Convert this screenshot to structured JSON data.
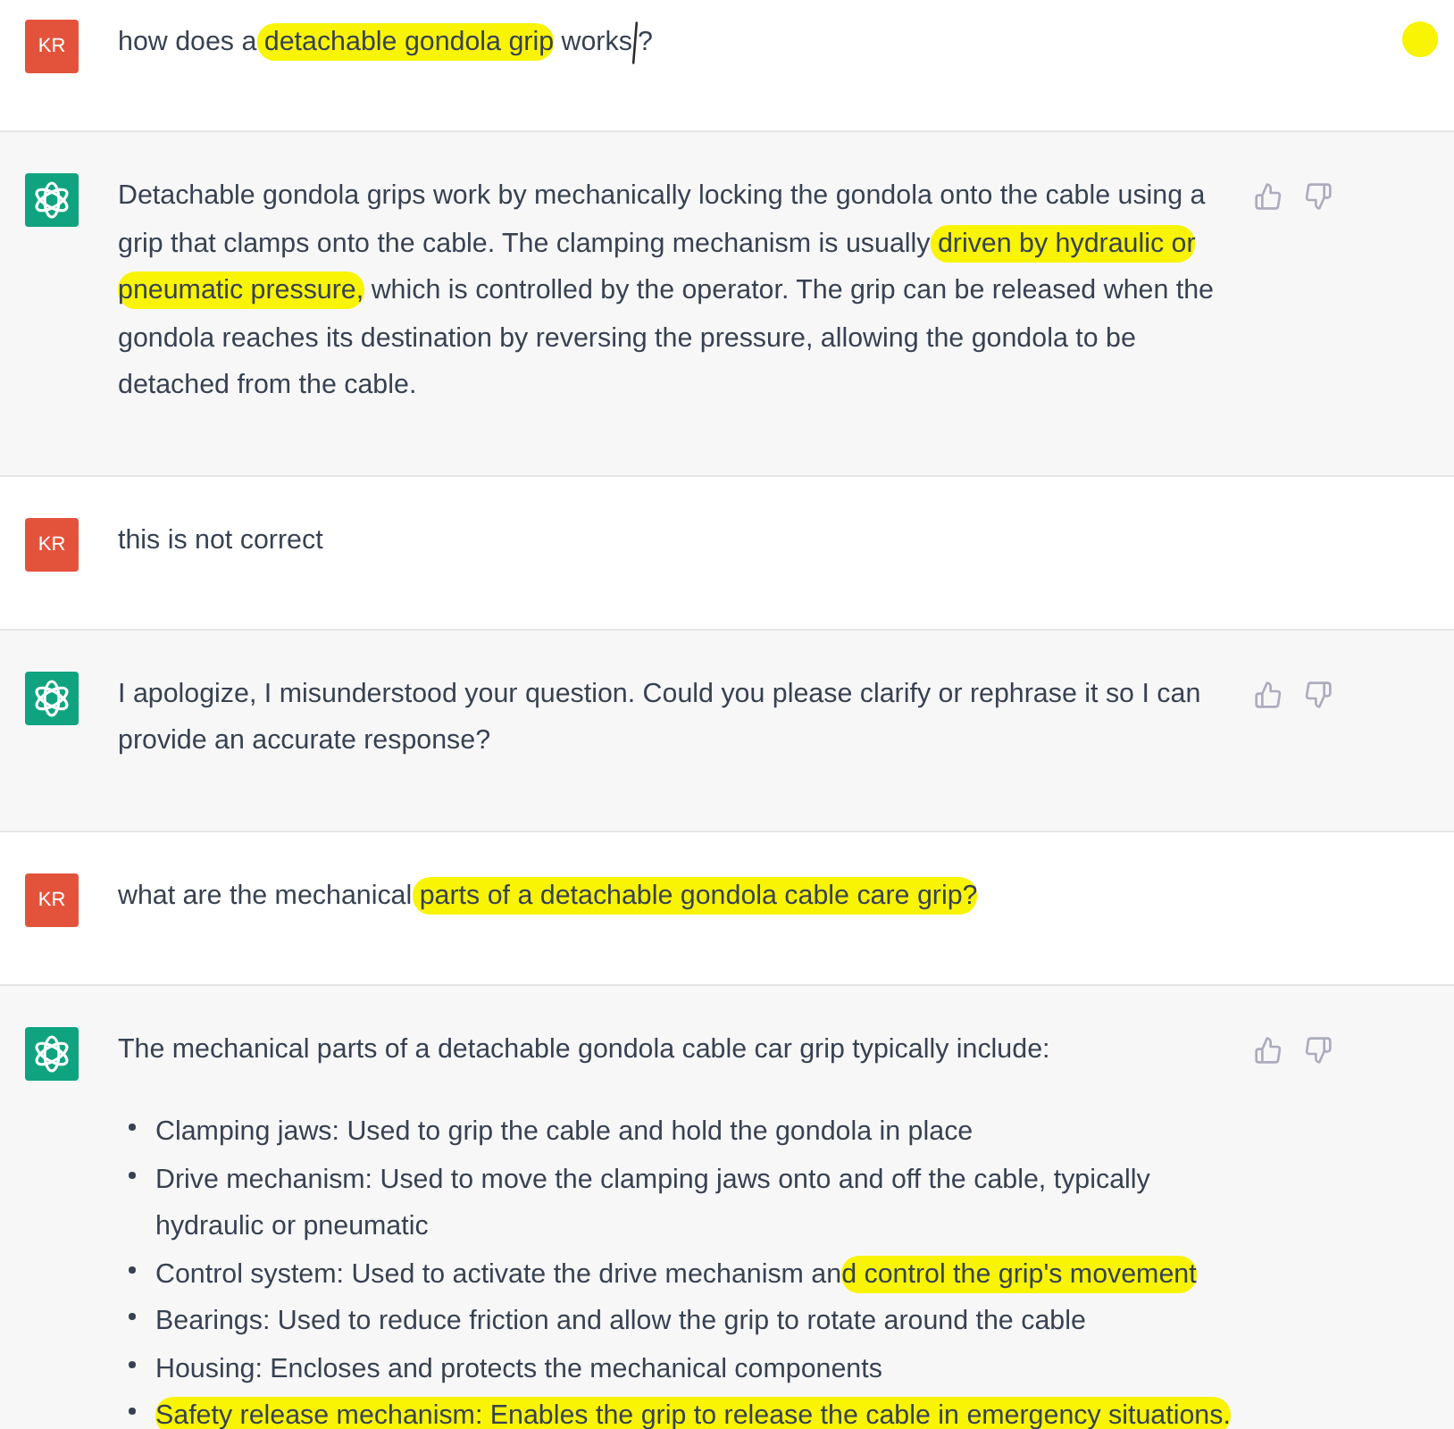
{
  "messages": [
    {
      "kind": "user",
      "avatar": "KR",
      "paragraph": [
        {
          "kind": "plain",
          "text": "how does a"
        },
        {
          "kind": "highlight",
          "text": " detachable gondola grip"
        },
        {
          "kind": "plain",
          "text": " work"
        },
        {
          "kind": "pen-mark",
          "text": "s"
        },
        {
          "kind": "plain",
          "text": "?"
        }
      ]
    },
    {
      "kind": "assistant",
      "paragraph": [
        {
          "kind": "plain",
          "text": "Detachable gondola grips work by mechanically locking the gondola onto the cable using a grip that clamps onto the cable. The clamping mechanism is usually"
        },
        {
          "kind": "highlight",
          "text": " driven by hydraulic or pneumatic pressure,"
        },
        {
          "kind": "plain",
          "text": " which is controlled by the operator. The grip can be released when the gondola reaches its destination by reversing the pressure, allowing the gondola to be detached from the cable."
        }
      ]
    },
    {
      "kind": "user",
      "avatar": "KR",
      "paragraph": [
        {
          "kind": "plain",
          "text": "this is not correct"
        }
      ]
    },
    {
      "kind": "assistant",
      "paragraph": [
        {
          "kind": "plain",
          "text": "I apologize, I misunderstood your question. Could you please clarify or rephrase it so I can provide an accurate response?"
        }
      ]
    },
    {
      "kind": "user",
      "avatar": "KR",
      "paragraph": [
        {
          "kind": "plain",
          "text": "what are the mechanical"
        },
        {
          "kind": "highlight",
          "text": " parts of a detachable gondola cable care grip?"
        }
      ]
    },
    {
      "kind": "assistant",
      "paragraph": [
        {
          "kind": "plain",
          "text": "The mechanical parts of a detachable gondola cable car grip typically include:"
        }
      ],
      "bullets": [
        [
          {
            "kind": "plain",
            "text": "Clamping jaws: Used to grip the cable and hold the gondola in place"
          }
        ],
        [
          {
            "kind": "plain",
            "text": "Drive mechanism: Used to move the clamping jaws onto and off the cable, typically hydraulic or pneumatic"
          }
        ],
        [
          {
            "kind": "plain",
            "text": "Control system: Used to activate the drive mechanism an"
          },
          {
            "kind": "highlight",
            "text": "d control the grip's movement"
          }
        ],
        [
          {
            "kind": "plain",
            "text": "Bearings: Used to reduce friction and allow the grip to rotate around the cable"
          }
        ],
        [
          {
            "kind": "plain",
            "text": "Housing: Encloses and protects the mechanical components"
          }
        ],
        [
          {
            "kind": "highlight",
            "text": "Safety release mechanism: Enables the grip to release the cable in emergency situations."
          }
        ]
      ]
    }
  ]
}
